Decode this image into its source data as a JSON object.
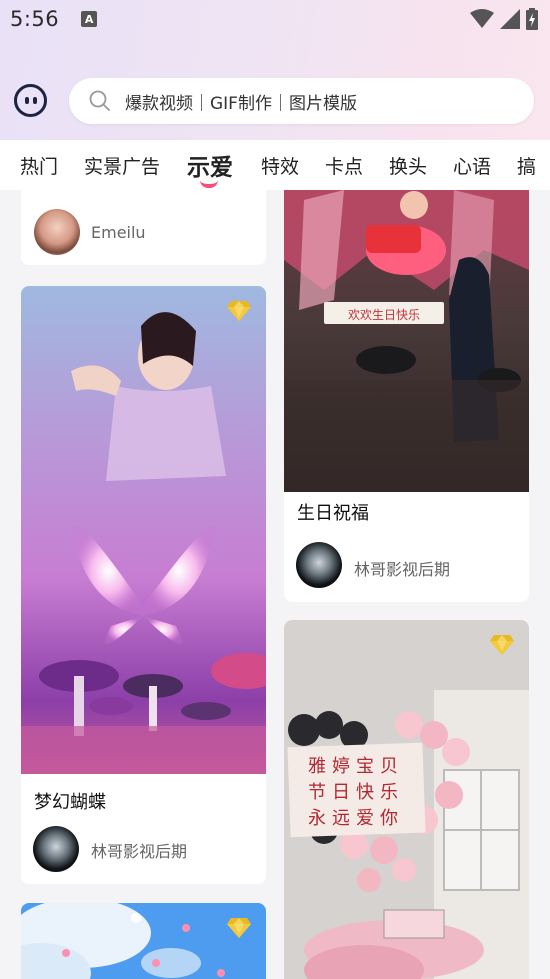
{
  "status": {
    "time": "5:56",
    "notification": "A"
  },
  "search": {
    "placeholder": "爆款视频｜GIF制作｜图片模版"
  },
  "tabs": [
    "热门",
    "实景广告",
    "示爱",
    "特效",
    "卡点",
    "换头",
    "心语",
    "搞"
  ],
  "active_tab": "示爱",
  "cards": {
    "top_left": {
      "author": "Emeilu"
    },
    "top_right": {
      "title": "生日祝福",
      "author": "林哥影视后期",
      "image_text": "欢欢生日快乐"
    },
    "mid_left": {
      "title": "梦幻蝴蝶",
      "author": "林哥影视后期"
    },
    "bottom_right": {
      "image_text": [
        "雅婷宝贝",
        "节日快乐",
        "永远爱你"
      ]
    }
  },
  "colors": {
    "accent": "#f0507a",
    "vip": "#e8b825"
  }
}
